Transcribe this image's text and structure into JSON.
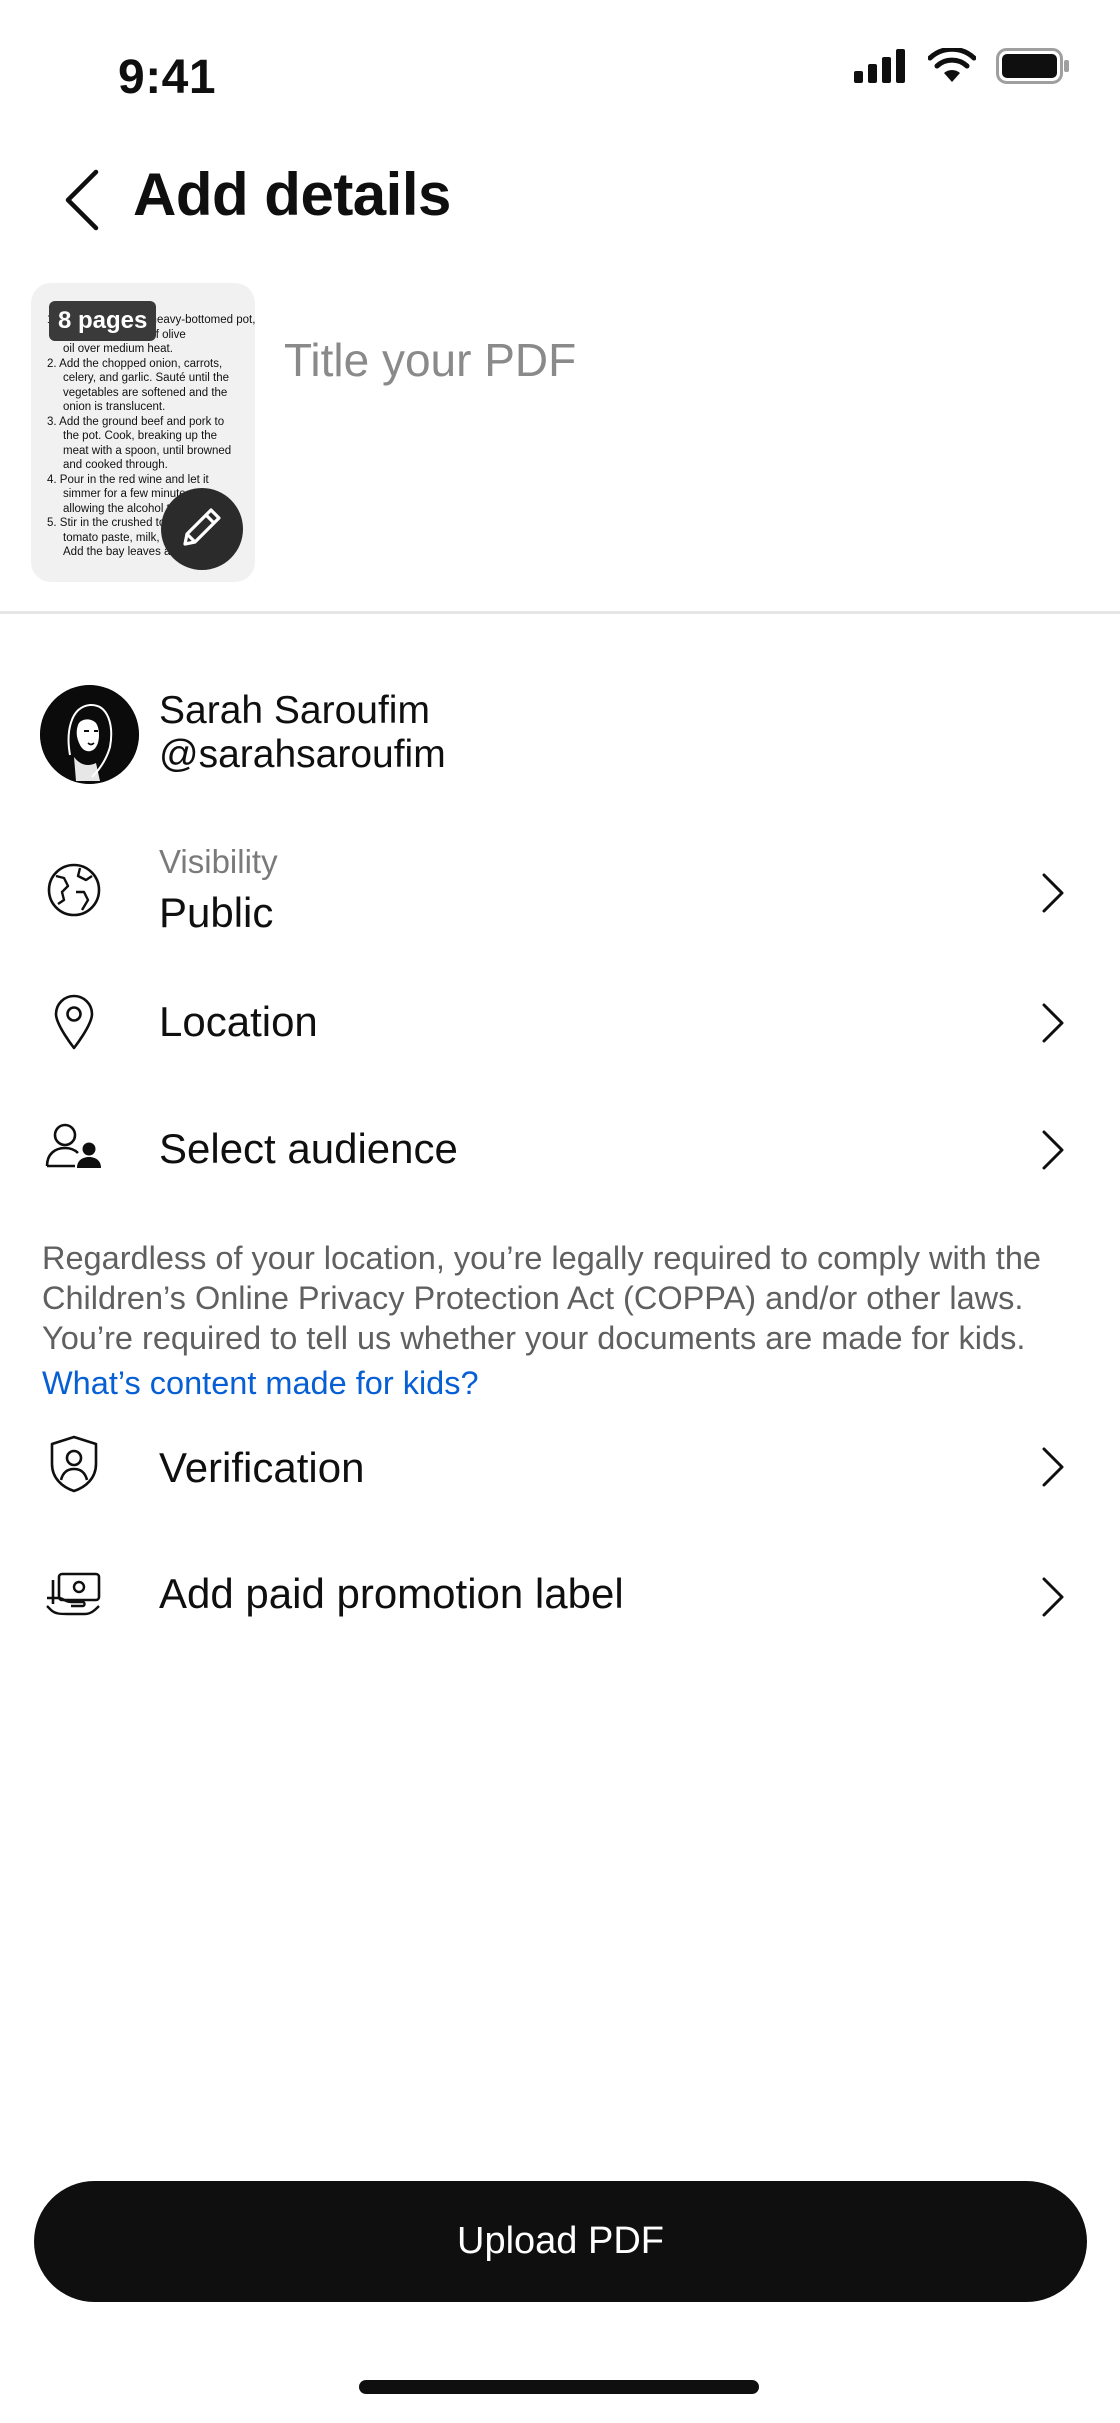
{
  "status_bar": {
    "time": "9:41"
  },
  "header": {
    "title": "Add details"
  },
  "document": {
    "pages_badge": "8 pages",
    "preview_lines": [
      "1. Heat olive oil in a heavy-bottomed pot,",
      "two tablespoons of olive",
      "oil over medium heat.",
      "2. Add the chopped onion, carrots,",
      "celery, and garlic. Sauté until the",
      "vegetables are softened and the",
      "onion is translucent.",
      "3. Add the ground beef and pork to",
      "the pot. Cook, breaking up the",
      "meat with a spoon, until browned",
      "and cooked through.",
      "4. Pour in the red wine and let it",
      "simmer for a few minutes,",
      "allowing the alcohol to cook off.",
      "5. Stir in the crushed tomatoes,",
      "tomato paste, milk, and oregano.",
      "Add the bay leaves and basil."
    ],
    "title_placeholder": "Title your PDF",
    "title_value": ""
  },
  "channel": {
    "name": "Sarah Saroufim",
    "handle": "@sarahsaroufim"
  },
  "settings": {
    "visibility": {
      "sublabel": "Visibility",
      "value": "Public",
      "icon": "globe-icon"
    },
    "location": {
      "label": "Location",
      "icon": "location-pin-icon"
    },
    "audience": {
      "label": "Select audience",
      "icon": "audience-icon"
    },
    "verification": {
      "label": "Verification",
      "icon": "shield-user-icon"
    },
    "paid_promotion": {
      "label": "Add paid promotion label",
      "icon": "paid-promotion-icon"
    }
  },
  "coppa": {
    "text": "Regardless of your location, you’re legally required to comply with the Children’s Online Privacy Protection Act (COPPA) and/or other laws. You’re required to tell us whether your documents are made for kids.",
    "link": "What’s content made for kids?"
  },
  "actions": {
    "upload_label": "Upload PDF"
  },
  "colors": {
    "primary_button": "#0f0f0f",
    "link": "#065fd4",
    "secondary_text": "#606060"
  }
}
